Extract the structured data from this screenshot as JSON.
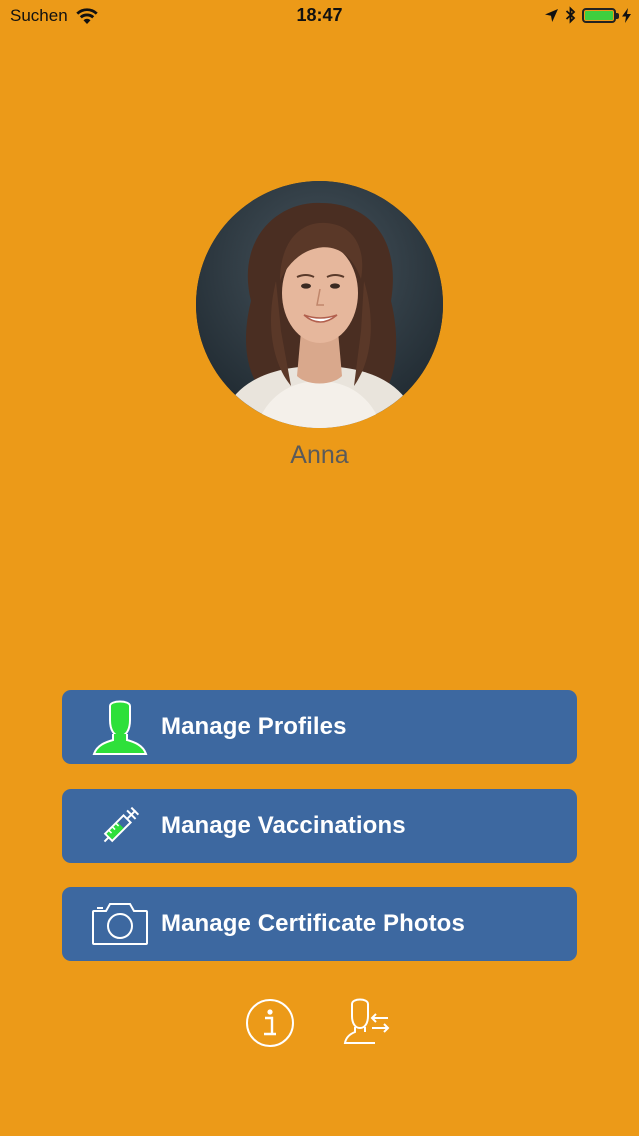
{
  "status_bar": {
    "carrier": "Suchen",
    "time": "18:47"
  },
  "profile": {
    "name": "Anna"
  },
  "menu": {
    "manage_profiles": "Manage Profiles",
    "manage_vaccinations": "Manage Vaccinations",
    "manage_certificate_photos": "Manage Certificate Photos"
  },
  "colors": {
    "background": "#ec9a18",
    "button": "#3d68a0",
    "profile_icon_fill": "#2ee03a"
  },
  "icons": {
    "profiles": "person-icon",
    "vaccinations": "syringe-icon",
    "photos": "camera-icon",
    "info": "info-icon",
    "switch_profile": "switch-profile-icon"
  }
}
